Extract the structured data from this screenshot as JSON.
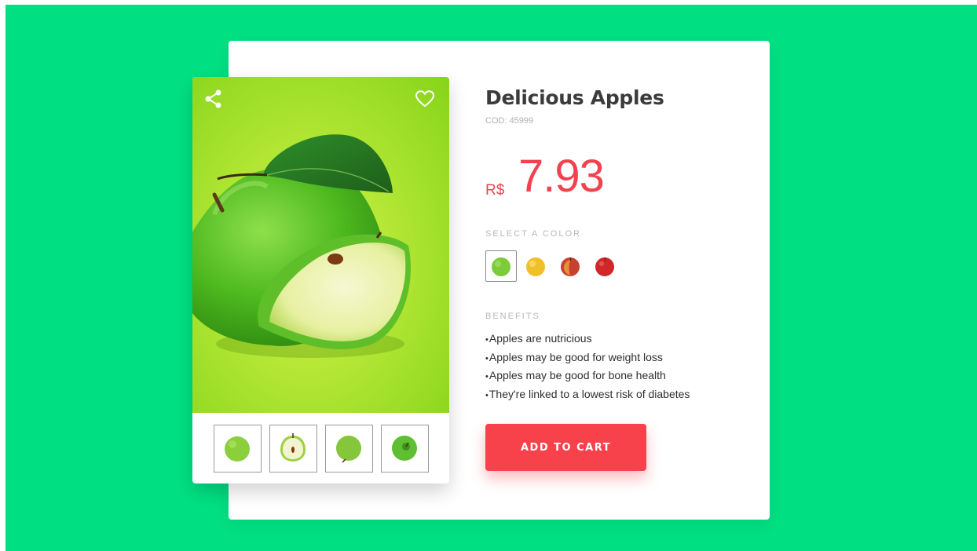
{
  "product": {
    "title": "Delicious Apples",
    "cod_label": "COD:",
    "cod_value": "45999",
    "currency": "R$",
    "price": "7.93"
  },
  "color_section": {
    "label": "SELECT A COLOR",
    "options": [
      {
        "name": "green-apple",
        "color": "#7ccb3a",
        "selected": true
      },
      {
        "name": "yellow-apple",
        "color": "#f0c02a",
        "selected": false
      },
      {
        "name": "red-yellow-apple",
        "color": "#c9402f",
        "selected": false
      },
      {
        "name": "red-apple",
        "color": "#d3262b",
        "selected": false
      }
    ]
  },
  "benefits": {
    "label": "BENEFITS",
    "items": [
      "Apples are nutricious",
      "Apples may be good for weight loss",
      "Apples may be good for bone health",
      "They're linked to a lowest risk of diabetes"
    ]
  },
  "actions": {
    "add_to_cart": "ADD TO CART"
  },
  "icons": {
    "share": "share-icon",
    "favorite": "heart-icon"
  },
  "colors": {
    "background": "#00e083",
    "accent": "#f7424b",
    "title": "#3b3b3b"
  }
}
